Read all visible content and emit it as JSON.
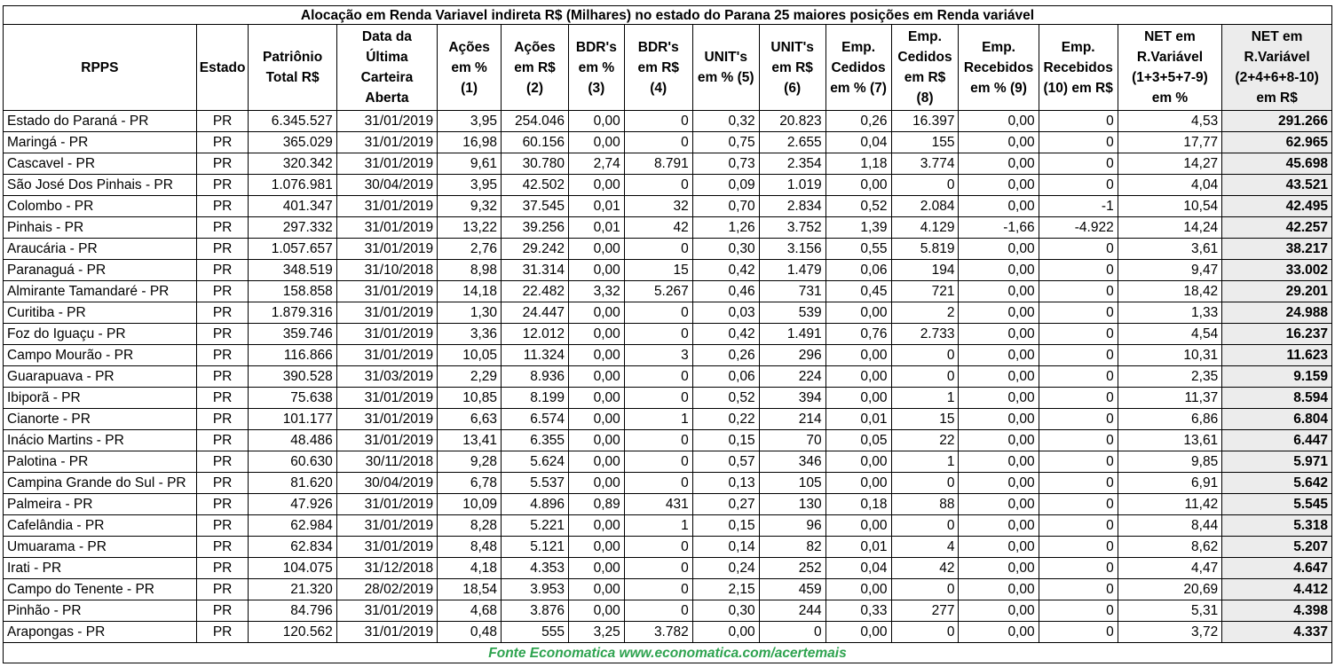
{
  "title": "Alocação em Renda Variavel indireta  R$ (Milhares) no estado do Parana 25 maiores posições em Renda variável",
  "columns": [
    [
      "RPPS"
    ],
    [
      "Estado"
    ],
    [
      "Patriônio",
      "Total R$"
    ],
    [
      "Data da",
      "Última",
      "Carteira",
      "Aberta"
    ],
    [
      "Ações",
      "em %",
      "(1)"
    ],
    [
      "Ações",
      "em R$",
      "(2)"
    ],
    [
      "BDR's",
      "em %",
      "(3)"
    ],
    [
      "BDR's",
      "em R$",
      "(4)"
    ],
    [
      "UNIT's",
      "em % (5)"
    ],
    [
      "UNIT's",
      "em R$",
      "(6)"
    ],
    [
      "Emp.",
      "Cedidos",
      "em % (7)"
    ],
    [
      "Emp.",
      "Cedidos",
      "em R$",
      "(8)"
    ],
    [
      "Emp.",
      "Recebidos",
      "em % (9)"
    ],
    [
      "Emp.",
      "Recebidos",
      "(10) em R$"
    ],
    [
      "NET em",
      "R.Variável",
      "(1+3+5+7-9)",
      "em %"
    ],
    [
      "NET em",
      "R.Variável",
      "(2+4+6+8-10)",
      "em R$"
    ]
  ],
  "rows": [
    [
      "Estado do Paraná - PR",
      "PR",
      "6.345.527",
      "31/01/2019",
      "3,95",
      "254.046",
      "0,00",
      "0",
      "0,32",
      "20.823",
      "0,26",
      "16.397",
      "0,00",
      "0",
      "4,53",
      "291.266"
    ],
    [
      "Maringá - PR",
      "PR",
      "365.029",
      "31/01/2019",
      "16,98",
      "60.156",
      "0,00",
      "0",
      "0,75",
      "2.655",
      "0,04",
      "155",
      "0,00",
      "0",
      "17,77",
      "62.965"
    ],
    [
      "Cascavel - PR",
      "PR",
      "320.342",
      "31/01/2019",
      "9,61",
      "30.780",
      "2,74",
      "8.791",
      "0,73",
      "2.354",
      "1,18",
      "3.774",
      "0,00",
      "0",
      "14,27",
      "45.698"
    ],
    [
      "São José Dos Pinhais - PR",
      "PR",
      "1.076.981",
      "30/04/2019",
      "3,95",
      "42.502",
      "0,00",
      "0",
      "0,09",
      "1.019",
      "0,00",
      "0",
      "0,00",
      "0",
      "4,04",
      "43.521"
    ],
    [
      "Colombo - PR",
      "PR",
      "401.347",
      "31/01/2019",
      "9,32",
      "37.545",
      "0,01",
      "32",
      "0,70",
      "2.834",
      "0,52",
      "2.084",
      "0,00",
      "-1",
      "10,54",
      "42.495"
    ],
    [
      "Pinhais - PR",
      "PR",
      "297.332",
      "31/01/2019",
      "13,22",
      "39.256",
      "0,01",
      "42",
      "1,26",
      "3.752",
      "1,39",
      "4.129",
      "-1,66",
      "-4.922",
      "14,24",
      "42.257"
    ],
    [
      "Araucária - PR",
      "PR",
      "1.057.657",
      "31/01/2019",
      "2,76",
      "29.242",
      "0,00",
      "0",
      "0,30",
      "3.156",
      "0,55",
      "5.819",
      "0,00",
      "0",
      "3,61",
      "38.217"
    ],
    [
      "Paranaguá - PR",
      "PR",
      "348.519",
      "31/10/2018",
      "8,98",
      "31.314",
      "0,00",
      "15",
      "0,42",
      "1.479",
      "0,06",
      "194",
      "0,00",
      "0",
      "9,47",
      "33.002"
    ],
    [
      "Almirante Tamandaré - PR",
      "PR",
      "158.858",
      "31/01/2019",
      "14,18",
      "22.482",
      "3,32",
      "5.267",
      "0,46",
      "731",
      "0,45",
      "721",
      "0,00",
      "0",
      "18,42",
      "29.201"
    ],
    [
      "Curitiba - PR",
      "PR",
      "1.879.316",
      "31/01/2019",
      "1,30",
      "24.447",
      "0,00",
      "0",
      "0,03",
      "539",
      "0,00",
      "2",
      "0,00",
      "0",
      "1,33",
      "24.988"
    ],
    [
      "Foz do Iguaçu - PR",
      "PR",
      "359.746",
      "31/01/2019",
      "3,36",
      "12.012",
      "0,00",
      "0",
      "0,42",
      "1.491",
      "0,76",
      "2.733",
      "0,00",
      "0",
      "4,54",
      "16.237"
    ],
    [
      "Campo Mourão - PR",
      "PR",
      "116.866",
      "31/01/2019",
      "10,05",
      "11.324",
      "0,00",
      "3",
      "0,26",
      "296",
      "0,00",
      "0",
      "0,00",
      "0",
      "10,31",
      "11.623"
    ],
    [
      "Guarapuava - PR",
      "PR",
      "390.528",
      "31/03/2019",
      "2,29",
      "8.936",
      "0,00",
      "0",
      "0,06",
      "224",
      "0,00",
      "0",
      "0,00",
      "0",
      "2,35",
      "9.159"
    ],
    [
      "Ibiporã - PR",
      "PR",
      "75.638",
      "31/01/2019",
      "10,85",
      "8.199",
      "0,00",
      "0",
      "0,52",
      "394",
      "0,00",
      "1",
      "0,00",
      "0",
      "11,37",
      "8.594"
    ],
    [
      "Cianorte - PR",
      "PR",
      "101.177",
      "31/01/2019",
      "6,63",
      "6.574",
      "0,00",
      "1",
      "0,22",
      "214",
      "0,01",
      "15",
      "0,00",
      "0",
      "6,86",
      "6.804"
    ],
    [
      "Inácio Martins - PR",
      "PR",
      "48.486",
      "31/01/2019",
      "13,41",
      "6.355",
      "0,00",
      "0",
      "0,15",
      "70",
      "0,05",
      "22",
      "0,00",
      "0",
      "13,61",
      "6.447"
    ],
    [
      "Palotina - PR",
      "PR",
      "60.630",
      "30/11/2018",
      "9,28",
      "5.624",
      "0,00",
      "0",
      "0,57",
      "346",
      "0,00",
      "1",
      "0,00",
      "0",
      "9,85",
      "5.971"
    ],
    [
      "Campina Grande do Sul - PR",
      "PR",
      "81.620",
      "30/04/2019",
      "6,78",
      "5.537",
      "0,00",
      "0",
      "0,13",
      "105",
      "0,00",
      "0",
      "0,00",
      "0",
      "6,91",
      "5.642"
    ],
    [
      "Palmeira - PR",
      "PR",
      "47.926",
      "31/01/2019",
      "10,09",
      "4.896",
      "0,89",
      "431",
      "0,27",
      "130",
      "0,18",
      "88",
      "0,00",
      "0",
      "11,42",
      "5.545"
    ],
    [
      "Cafelândia - PR",
      "PR",
      "62.984",
      "31/01/2019",
      "8,28",
      "5.221",
      "0,00",
      "1",
      "0,15",
      "96",
      "0,00",
      "0",
      "0,00",
      "0",
      "8,44",
      "5.318"
    ],
    [
      "Umuarama - PR",
      "PR",
      "62.834",
      "31/01/2019",
      "8,48",
      "5.121",
      "0,00",
      "0",
      "0,14",
      "82",
      "0,01",
      "4",
      "0,00",
      "0",
      "8,62",
      "5.207"
    ],
    [
      "Irati - PR",
      "PR",
      "104.075",
      "31/12/2018",
      "4,18",
      "4.353",
      "0,00",
      "0",
      "0,24",
      "252",
      "0,04",
      "42",
      "0,00",
      "0",
      "4,47",
      "4.647"
    ],
    [
      "Campo do Tenente - PR",
      "PR",
      "21.320",
      "28/02/2019",
      "18,54",
      "3.953",
      "0,00",
      "0",
      "2,15",
      "459",
      "0,00",
      "0",
      "0,00",
      "0",
      "20,69",
      "4.412"
    ],
    [
      "Pinhão - PR",
      "PR",
      "84.796",
      "31/01/2019",
      "4,68",
      "3.876",
      "0,00",
      "0",
      "0,30",
      "244",
      "0,33",
      "277",
      "0,00",
      "0",
      "5,31",
      "4.398"
    ],
    [
      "Arapongas - PR",
      "PR",
      "120.562",
      "31/01/2019",
      "0,48",
      "555",
      "3,25",
      "3.782",
      "0,00",
      "0",
      "0,00",
      "0",
      "0,00",
      "0",
      "3,72",
      "4.337"
    ]
  ],
  "footer": "Fonte Economatica www.economatica.com/acertemais",
  "colors": {
    "footer_text": "#2ea34f",
    "net_column_bg": "#ececec",
    "grid": "#000000"
  }
}
